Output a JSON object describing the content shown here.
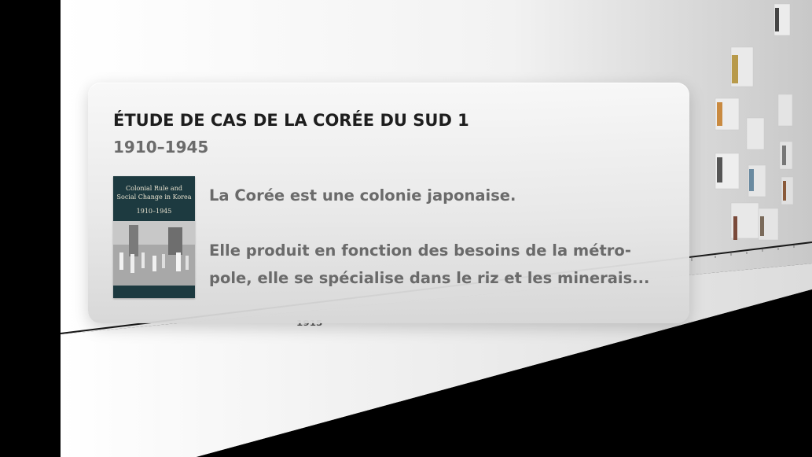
{
  "event": {
    "title": "ÉTUDE DE CAS DE LA CORÉE DU SUD 1",
    "dates": "1910–1945",
    "paragraphs": [
      "La Corée est une colonie japonaise.",
      "Elle produit en fonction des besoins de la métro-pole, elle se spécialise dans le riz et les minerais..."
    ],
    "paragraph_2_line_1": "Elle produit en fonction des besoins de la métro-",
    "paragraph_2_line_2": "pole, elle se spécialise dans le riz et les minerais..."
  },
  "book_cover": {
    "title_line_1": "Colonial Rule and",
    "title_line_2": "Social Change in Korea",
    "years": "1910–1945"
  },
  "timeline": {
    "visible_year": "1915"
  },
  "colors": {
    "cover": "#1d3a40",
    "title": "#1e1e1e",
    "dates": "#6b6b6b",
    "body": "#6a6a6a"
  }
}
